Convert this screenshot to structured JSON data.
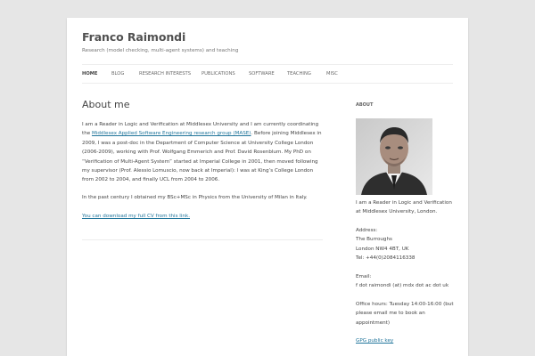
{
  "site": {
    "title": "Franco Raimondi",
    "description": "Research (model checking, multi-agent systems) and teaching"
  },
  "nav": {
    "items": [
      {
        "label": "HOME",
        "active": true
      },
      {
        "label": "BLOG"
      },
      {
        "label": "RESEARCH INTERESTS"
      },
      {
        "label": "PUBLICATIONS"
      },
      {
        "label": "SOFTWARE"
      },
      {
        "label": "TEACHING"
      },
      {
        "label": "MISC"
      }
    ]
  },
  "main": {
    "title": "About me",
    "p1_before_link": "I am a Reader in Logic and Verification at Middlesex University and I am currently coordinating the ",
    "p1_link": "Middlesex Applied Software Engineering research group (MASE)",
    "p1_after_link": ". Before joining Middlesex in 2009, I was a post-doc in the Department of Computer Science at University College London (2006-2009), working with Prof. Wolfgang Emmerich and Prof. David Rosenblum. My PhD on “Verification of Multi-Agent System” started at Imperial College in 2001, then moved following my supervisor (Prof. Alessio Lomuscio, now back at Imperial): I was at King’s College London from 2002 to 2004, and finally UCL from 2004 to 2006.",
    "p2": "In the past century I obtained my BSc+MSc in Physics from the University of Milan in Italy.",
    "cv_link": "You can download my full CV from this link."
  },
  "sidebar": {
    "title": "ABOUT",
    "caption": "I am a Reader in Logic and Verification at Middlesex University, London.",
    "address_label": "Address:",
    "address_line1": "The Burroughs",
    "address_line2": "London NW4 4BT, UK",
    "tel": "Tel: +44(0)2084116338",
    "email_label": "Email:",
    "email": "f dot raimondi (at) mdx dot ac dot uk",
    "office_hours": "Office hours: Tuesday 14:00-16:00 (but please email me to book an appointment)",
    "gpg_link": "GPG public key"
  }
}
